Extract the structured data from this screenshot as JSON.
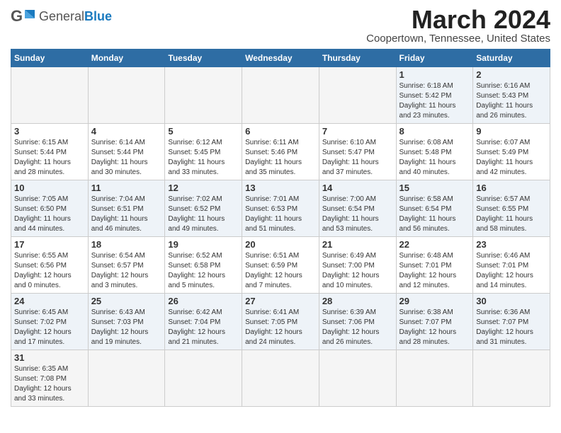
{
  "header": {
    "logo_general": "General",
    "logo_blue": "Blue",
    "month_title": "March 2024",
    "location": "Coopertown, Tennessee, United States"
  },
  "days_of_week": [
    "Sunday",
    "Monday",
    "Tuesday",
    "Wednesday",
    "Thursday",
    "Friday",
    "Saturday"
  ],
  "weeks": [
    {
      "days": [
        {
          "number": "",
          "info": "",
          "empty": true
        },
        {
          "number": "",
          "info": "",
          "empty": true
        },
        {
          "number": "",
          "info": "",
          "empty": true
        },
        {
          "number": "",
          "info": "",
          "empty": true
        },
        {
          "number": "",
          "info": "",
          "empty": true
        },
        {
          "number": "1",
          "info": "Sunrise: 6:18 AM\nSunset: 5:42 PM\nDaylight: 11 hours\nand 23 minutes."
        },
        {
          "number": "2",
          "info": "Sunrise: 6:16 AM\nSunset: 5:43 PM\nDaylight: 11 hours\nand 26 minutes."
        }
      ]
    },
    {
      "days": [
        {
          "number": "3",
          "info": "Sunrise: 6:15 AM\nSunset: 5:44 PM\nDaylight: 11 hours\nand 28 minutes."
        },
        {
          "number": "4",
          "info": "Sunrise: 6:14 AM\nSunset: 5:44 PM\nDaylight: 11 hours\nand 30 minutes."
        },
        {
          "number": "5",
          "info": "Sunrise: 6:12 AM\nSunset: 5:45 PM\nDaylight: 11 hours\nand 33 minutes."
        },
        {
          "number": "6",
          "info": "Sunrise: 6:11 AM\nSunset: 5:46 PM\nDaylight: 11 hours\nand 35 minutes."
        },
        {
          "number": "7",
          "info": "Sunrise: 6:10 AM\nSunset: 5:47 PM\nDaylight: 11 hours\nand 37 minutes."
        },
        {
          "number": "8",
          "info": "Sunrise: 6:08 AM\nSunset: 5:48 PM\nDaylight: 11 hours\nand 40 minutes."
        },
        {
          "number": "9",
          "info": "Sunrise: 6:07 AM\nSunset: 5:49 PM\nDaylight: 11 hours\nand 42 minutes."
        }
      ]
    },
    {
      "days": [
        {
          "number": "10",
          "info": "Sunrise: 7:05 AM\nSunset: 6:50 PM\nDaylight: 11 hours\nand 44 minutes."
        },
        {
          "number": "11",
          "info": "Sunrise: 7:04 AM\nSunset: 6:51 PM\nDaylight: 11 hours\nand 46 minutes."
        },
        {
          "number": "12",
          "info": "Sunrise: 7:02 AM\nSunset: 6:52 PM\nDaylight: 11 hours\nand 49 minutes."
        },
        {
          "number": "13",
          "info": "Sunrise: 7:01 AM\nSunset: 6:53 PM\nDaylight: 11 hours\nand 51 minutes."
        },
        {
          "number": "14",
          "info": "Sunrise: 7:00 AM\nSunset: 6:54 PM\nDaylight: 11 hours\nand 53 minutes."
        },
        {
          "number": "15",
          "info": "Sunrise: 6:58 AM\nSunset: 6:54 PM\nDaylight: 11 hours\nand 56 minutes."
        },
        {
          "number": "16",
          "info": "Sunrise: 6:57 AM\nSunset: 6:55 PM\nDaylight: 11 hours\nand 58 minutes."
        }
      ]
    },
    {
      "days": [
        {
          "number": "17",
          "info": "Sunrise: 6:55 AM\nSunset: 6:56 PM\nDaylight: 12 hours\nand 0 minutes."
        },
        {
          "number": "18",
          "info": "Sunrise: 6:54 AM\nSunset: 6:57 PM\nDaylight: 12 hours\nand 3 minutes."
        },
        {
          "number": "19",
          "info": "Sunrise: 6:52 AM\nSunset: 6:58 PM\nDaylight: 12 hours\nand 5 minutes."
        },
        {
          "number": "20",
          "info": "Sunrise: 6:51 AM\nSunset: 6:59 PM\nDaylight: 12 hours\nand 7 minutes."
        },
        {
          "number": "21",
          "info": "Sunrise: 6:49 AM\nSunset: 7:00 PM\nDaylight: 12 hours\nand 10 minutes."
        },
        {
          "number": "22",
          "info": "Sunrise: 6:48 AM\nSunset: 7:01 PM\nDaylight: 12 hours\nand 12 minutes."
        },
        {
          "number": "23",
          "info": "Sunrise: 6:46 AM\nSunset: 7:01 PM\nDaylight: 12 hours\nand 14 minutes."
        }
      ]
    },
    {
      "days": [
        {
          "number": "24",
          "info": "Sunrise: 6:45 AM\nSunset: 7:02 PM\nDaylight: 12 hours\nand 17 minutes."
        },
        {
          "number": "25",
          "info": "Sunrise: 6:43 AM\nSunset: 7:03 PM\nDaylight: 12 hours\nand 19 minutes."
        },
        {
          "number": "26",
          "info": "Sunrise: 6:42 AM\nSunset: 7:04 PM\nDaylight: 12 hours\nand 21 minutes."
        },
        {
          "number": "27",
          "info": "Sunrise: 6:41 AM\nSunset: 7:05 PM\nDaylight: 12 hours\nand 24 minutes."
        },
        {
          "number": "28",
          "info": "Sunrise: 6:39 AM\nSunset: 7:06 PM\nDaylight: 12 hours\nand 26 minutes."
        },
        {
          "number": "29",
          "info": "Sunrise: 6:38 AM\nSunset: 7:07 PM\nDaylight: 12 hours\nand 28 minutes."
        },
        {
          "number": "30",
          "info": "Sunrise: 6:36 AM\nSunset: 7:07 PM\nDaylight: 12 hours\nand 31 minutes."
        }
      ]
    },
    {
      "days": [
        {
          "number": "31",
          "info": "Sunrise: 6:35 AM\nSunset: 7:08 PM\nDaylight: 12 hours\nand 33 minutes."
        },
        {
          "number": "",
          "info": "",
          "empty": true
        },
        {
          "number": "",
          "info": "",
          "empty": true
        },
        {
          "number": "",
          "info": "",
          "empty": true
        },
        {
          "number": "",
          "info": "",
          "empty": true
        },
        {
          "number": "",
          "info": "",
          "empty": true
        },
        {
          "number": "",
          "info": "",
          "empty": true
        }
      ]
    }
  ]
}
